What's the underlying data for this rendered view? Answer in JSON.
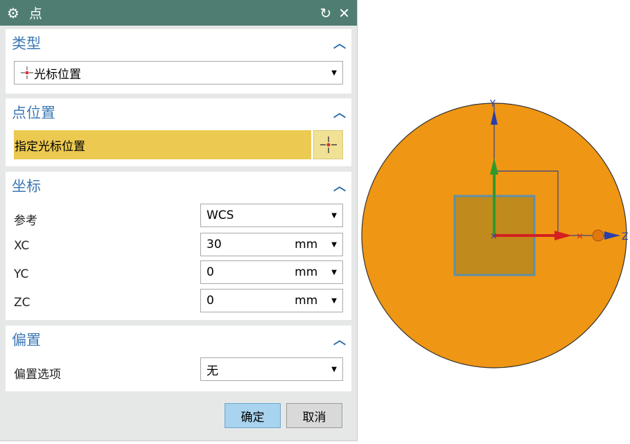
{
  "dialog": {
    "title": "点",
    "icons": [
      "gear-icon",
      "reset-icon",
      "close-icon"
    ]
  },
  "type_section": {
    "title": "类型",
    "selected": "光标位置"
  },
  "point_section": {
    "title": "点位置",
    "prompt": "指定光标位置"
  },
  "coords_section": {
    "title": "坐标",
    "reference_label": "参考",
    "reference_value": "WCS",
    "fields": [
      {
        "label": "XC",
        "value": "30",
        "unit": "mm"
      },
      {
        "label": "YC",
        "value": "0",
        "unit": "mm"
      },
      {
        "label": "ZC",
        "value": "0",
        "unit": "mm"
      }
    ]
  },
  "offset_section": {
    "title": "偏置",
    "option_label": "偏置选项",
    "option_value": "无"
  },
  "buttons": {
    "ok": "确定",
    "cancel": "取消"
  },
  "viewport": {
    "axis_y": "Y",
    "axis_z": "Z",
    "colors": {
      "body": "#ef9614",
      "x_axis": "#d42020",
      "y_axis": "#2e9a2e",
      "z_axis": "#2a3fa8"
    }
  }
}
